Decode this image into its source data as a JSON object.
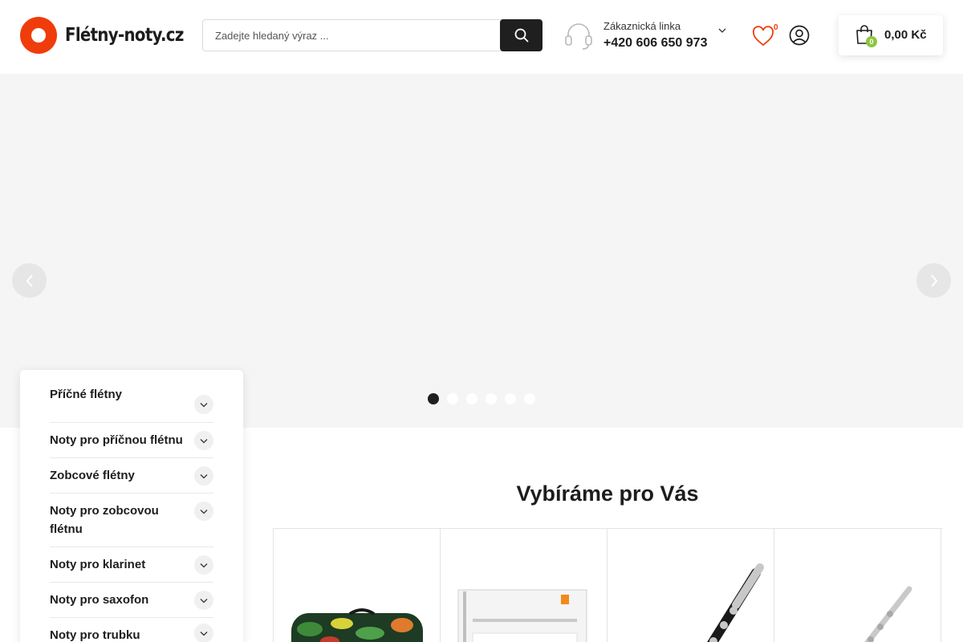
{
  "header": {
    "logo_text": "Flétny-noty.cz",
    "search": {
      "placeholder": "Zadejte hledaný výraz ..."
    },
    "hotline": {
      "label": "Zákaznická linka",
      "phone": "+420 606 650 973"
    },
    "wishlist_count": "0",
    "cart": {
      "count": "0",
      "total": "0,00 Kč"
    }
  },
  "slider": {
    "slide_count": 6,
    "active_index": 0
  },
  "categories": [
    {
      "label": "Příčné flétny"
    },
    {
      "label": "Noty pro příčnou flétnu"
    },
    {
      "label": "Zobcové flétny"
    },
    {
      "label": "Noty pro zobcovou flétnu"
    },
    {
      "label": "Noty pro klarinet"
    },
    {
      "label": "Noty pro saxofon"
    },
    {
      "label": "Noty pro trubku"
    }
  ],
  "section": {
    "title": "Vybíráme pro Vás"
  },
  "colors": {
    "accent": "#f03c0b",
    "badge": "#8cc63f",
    "dark": "#1f1f1f"
  }
}
